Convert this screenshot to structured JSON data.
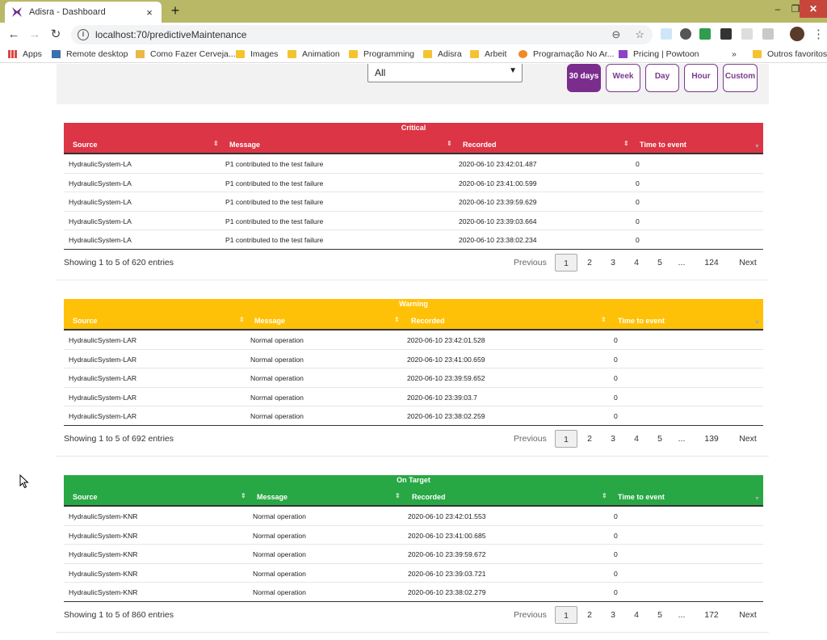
{
  "browser": {
    "tab_title": "Adisra - Dashboard",
    "tab_close": "×",
    "new_tab": "+",
    "url": "localhost:70/predictiveMaintenance",
    "window_controls": {
      "minimize": "–",
      "maximize": "❐",
      "close": "✕"
    },
    "bookmarks": [
      {
        "label": "Apps",
        "icon": "apps-grid-icon"
      },
      {
        "label": "Remote desktop",
        "icon": "remote-desktop-icon"
      },
      {
        "label": "Como Fazer Cerveja...",
        "icon": "beer-icon"
      },
      {
        "label": "Images",
        "icon": "folder-icon"
      },
      {
        "label": "Animation",
        "icon": "folder-icon"
      },
      {
        "label": "Programming",
        "icon": "folder-icon"
      },
      {
        "label": "Adisra",
        "icon": "folder-icon"
      },
      {
        "label": "Arbeit",
        "icon": "folder-icon"
      },
      {
        "label": "Programação No Ar...",
        "icon": "globe-icon"
      },
      {
        "label": "Pricing | Powtoon",
        "icon": "powtoon-icon"
      }
    ],
    "bookmarks_overflow": "»",
    "other_bookmarks": "Outros favoritos"
  },
  "filter": {
    "select_value": "All",
    "ranges": [
      "30 days",
      "Week",
      "Day",
      "Hour",
      "Custom"
    ],
    "active_range": "30 days",
    "accent": "#7b2d8e"
  },
  "columns": [
    "Source",
    "Message",
    "Recorded",
    "Time to event"
  ],
  "sections": {
    "critical": {
      "title": "Critical",
      "color": "#dc3545",
      "rows": [
        [
          "HydraulicSystem-LA",
          "P1 contributed to the test failure",
          "2020-06-10 23:42:01.487",
          "0"
        ],
        [
          "HydraulicSystem-LA",
          "P1 contributed to the test failure",
          "2020-06-10 23:41:00.599",
          "0"
        ],
        [
          "HydraulicSystem-LA",
          "P1 contributed to the test failure",
          "2020-06-10 23:39:59.629",
          "0"
        ],
        [
          "HydraulicSystem-LA",
          "P1 contributed to the test failure",
          "2020-06-10 23:39:03.664",
          "0"
        ],
        [
          "HydraulicSystem-LA",
          "P1 contributed to the test failure",
          "2020-06-10 23:38:02.234",
          "0"
        ]
      ],
      "info": "Showing 1 to 5 of 620 entries",
      "pages": [
        "Previous",
        "1",
        "2",
        "3",
        "4",
        "5",
        "...",
        "124",
        "Next"
      ]
    },
    "warning": {
      "title": "Warning",
      "color": "#ffc107",
      "rows": [
        [
          "HydraulicSystem-LAR",
          "Normal operation",
          "2020-06-10 23:42:01.528",
          "0"
        ],
        [
          "HydraulicSystem-LAR",
          "Normal operation",
          "2020-06-10 23:41:00.659",
          "0"
        ],
        [
          "HydraulicSystem-LAR",
          "Normal operation",
          "2020-06-10 23:39:59.652",
          "0"
        ],
        [
          "HydraulicSystem-LAR",
          "Normal operation",
          "2020-06-10 23:39:03.7",
          "0"
        ],
        [
          "HydraulicSystem-LAR",
          "Normal operation",
          "2020-06-10 23:38:02.259",
          "0"
        ]
      ],
      "info": "Showing 1 to 5 of 692 entries",
      "pages": [
        "Previous",
        "1",
        "2",
        "3",
        "4",
        "5",
        "...",
        "139",
        "Next"
      ]
    },
    "on_target": {
      "title": "On Target",
      "color": "#28a745",
      "rows": [
        [
          "HydraulicSystem-KNR",
          "Normal operation",
          "2020-06-10 23:42:01.553",
          "0"
        ],
        [
          "HydraulicSystem-KNR",
          "Normal operation",
          "2020-06-10 23:41:00.685",
          "0"
        ],
        [
          "HydraulicSystem-KNR",
          "Normal operation",
          "2020-06-10 23:39:59.672",
          "0"
        ],
        [
          "HydraulicSystem-KNR",
          "Normal operation",
          "2020-06-10 23:39:03.721",
          "0"
        ],
        [
          "HydraulicSystem-KNR",
          "Normal operation",
          "2020-06-10 23:38:02.279",
          "0"
        ]
      ],
      "info": "Showing 1 to 5 of 860 entries",
      "pages": [
        "Previous",
        "1",
        "2",
        "3",
        "4",
        "5",
        "...",
        "172",
        "Next"
      ]
    }
  }
}
